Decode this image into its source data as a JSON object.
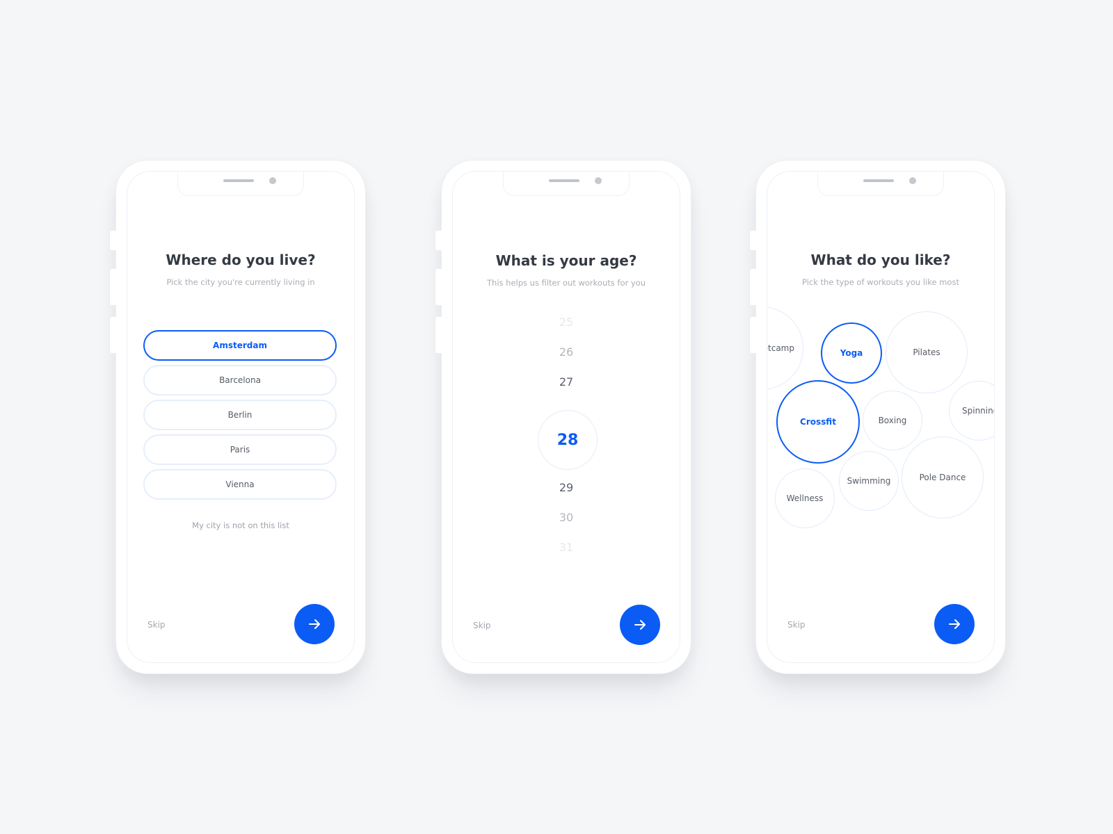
{
  "colors": {
    "accent": "#0a5cf5",
    "background": "#f5f6f8",
    "title": "#343a44",
    "muted": "#a9adb5",
    "bubble_border": "#e2ebfb"
  },
  "screens": [
    {
      "title": "Where do you live?",
      "subtitle": "Pick the city you're currently living in",
      "cities": [
        {
          "label": "Amsterdam",
          "selected": true
        },
        {
          "label": "Barcelona",
          "selected": false
        },
        {
          "label": "Berlin",
          "selected": false
        },
        {
          "label": "Paris",
          "selected": false
        },
        {
          "label": "Vienna",
          "selected": false
        }
      ],
      "not_listed_link": "My city is not on this list",
      "skip_label": "Skip",
      "next_icon": "arrow-right-icon"
    },
    {
      "title": "What is your age?",
      "subtitle": "This helps us filter out workouts for you",
      "ages_above": [
        "25",
        "26",
        "27"
      ],
      "selected_age": "28",
      "ages_below": [
        "29",
        "30",
        "31"
      ],
      "skip_label": "Skip",
      "next_icon": "arrow-right-icon"
    },
    {
      "title": "What do you like?",
      "subtitle": "Pick the type of workouts you like most",
      "workouts": [
        {
          "label": "Bootcamp",
          "selected": false
        },
        {
          "label": "Yoga",
          "selected": true
        },
        {
          "label": "Pilates",
          "selected": false
        },
        {
          "label": "Crossfit",
          "selected": true
        },
        {
          "label": "Boxing",
          "selected": false
        },
        {
          "label": "Spinning",
          "selected": false
        },
        {
          "label": "Wellness",
          "selected": false
        },
        {
          "label": "Swimming",
          "selected": false
        },
        {
          "label": "Pole Dance",
          "selected": false
        }
      ],
      "skip_label": "Skip",
      "next_icon": "arrow-right-icon"
    }
  ]
}
